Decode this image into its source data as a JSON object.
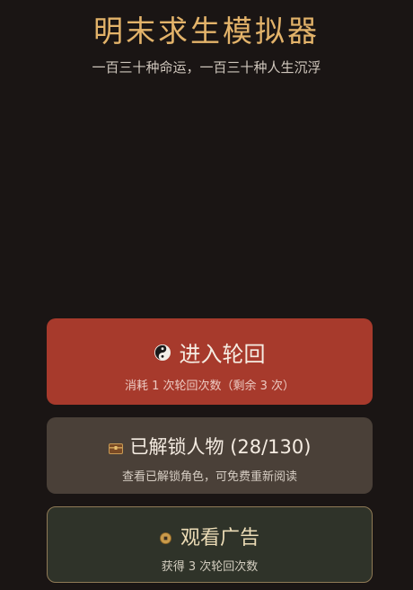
{
  "header": {
    "title": "明末求生模拟器",
    "subtitle": "一百三十种命运，一百三十种人生沉浮"
  },
  "actions": {
    "play": {
      "icon": "yin-yang-icon",
      "label": "进入轮回",
      "sub": "消耗 1 次轮回次数（剩余 3 次）",
      "color": "#a73a2c"
    },
    "unlocked": {
      "icon": "treasure-chest-icon",
      "label": "已解锁人物 (28/130)",
      "sub": "查看已解锁角色，可免费重新阅读",
      "color": "#4a4038"
    },
    "ad": {
      "icon": "coin-icon",
      "label": "观看广告",
      "sub": "获得 3 次轮回次数",
      "color": "#2f3329",
      "border_color": "#8f7a56"
    }
  },
  "theme": {
    "background": "#1a1514",
    "title_color": "#e3b36a"
  }
}
